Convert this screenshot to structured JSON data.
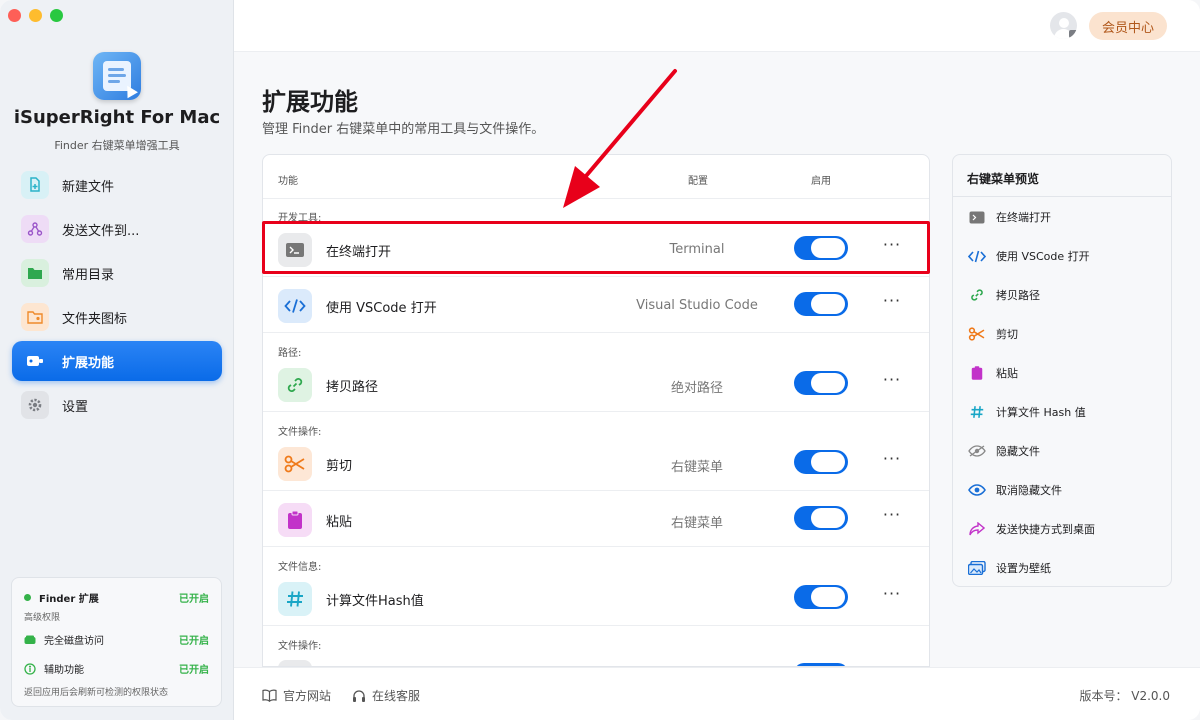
{
  "app": {
    "name": "iSuperRight For Mac",
    "subtitle": "Finder 右键菜单增强工具"
  },
  "nav": [
    {
      "label": "新建文件",
      "icon": "new-file-icon",
      "color": "#2ab3c9"
    },
    {
      "label": "发送文件到...",
      "icon": "send-file-icon",
      "color": "#9a55c9"
    },
    {
      "label": "常用目录",
      "icon": "folder-icon",
      "color": "#2fa84f"
    },
    {
      "label": "文件夹图标",
      "icon": "folder-image-icon",
      "color": "#ef8a2a"
    },
    {
      "label": "扩展功能",
      "icon": "extension-icon",
      "color": "#ffffff",
      "active": true
    },
    {
      "label": "设置",
      "icon": "gear-icon",
      "color": "#7a7d83"
    }
  ],
  "permissions": {
    "finder": {
      "label": "Finder 扩展",
      "status": "已开启"
    },
    "advanced_label": "高级权限",
    "disk": {
      "label": "完全磁盘访问",
      "status": "已开启"
    },
    "accessibility": {
      "label": "辅助功能",
      "status": "已开启"
    },
    "hint": "返回应用后会刷新可检测的权限状态"
  },
  "header": {
    "vip_label": "会员中心"
  },
  "page": {
    "title": "扩展功能",
    "subtitle": "管理 Finder 右键菜单中的常用工具与文件操作。"
  },
  "table": {
    "headers": {
      "feature": "功能",
      "config": "配置",
      "enabled": "启用"
    },
    "groups": [
      "开发工具:",
      "路径:",
      "文件操作:",
      "文件信息:",
      "文件操作:"
    ],
    "rows": [
      {
        "name": "在终端打开",
        "config": "Terminal",
        "enabled": true,
        "icon": "terminal-icon"
      },
      {
        "name": "使用 VSCode 打开",
        "config": "Visual Studio Code",
        "enabled": true,
        "icon": "code-icon"
      },
      {
        "name": "拷贝路径",
        "config": "绝对路径",
        "enabled": true,
        "icon": "link-icon"
      },
      {
        "name": "剪切",
        "config": "右键菜单",
        "enabled": true,
        "icon": "scissors-icon"
      },
      {
        "name": "粘贴",
        "config": "右键菜单",
        "enabled": true,
        "icon": "clipboard-icon"
      },
      {
        "name": "计算文件Hash值",
        "config": "",
        "enabled": true,
        "icon": "hash-icon"
      }
    ]
  },
  "preview": {
    "title": "右键菜单预览",
    "items": [
      {
        "label": "在终端打开",
        "icon": "terminal-icon"
      },
      {
        "label": "使用 VSCode 打开",
        "icon": "code-icon"
      },
      {
        "label": "拷贝路径",
        "icon": "link-icon"
      },
      {
        "label": "剪切",
        "icon": "scissors-icon"
      },
      {
        "label": "粘贴",
        "icon": "clipboard-icon"
      },
      {
        "label": "计算文件 Hash 值",
        "icon": "hash-icon"
      },
      {
        "label": "隐藏文件",
        "icon": "eye-slash-icon"
      },
      {
        "label": "取消隐藏文件",
        "icon": "eye-icon"
      },
      {
        "label": "发送快捷方式到桌面",
        "icon": "share-arrow-icon"
      },
      {
        "label": "设置为壁纸",
        "icon": "wallpaper-icon"
      }
    ]
  },
  "footer": {
    "website": "官方网站",
    "support": "在线客服",
    "version": "版本号： V2.0.0"
  },
  "colors": {
    "accent": "#0a6be8",
    "highlight": "#e8001a",
    "success": "#34b249"
  }
}
